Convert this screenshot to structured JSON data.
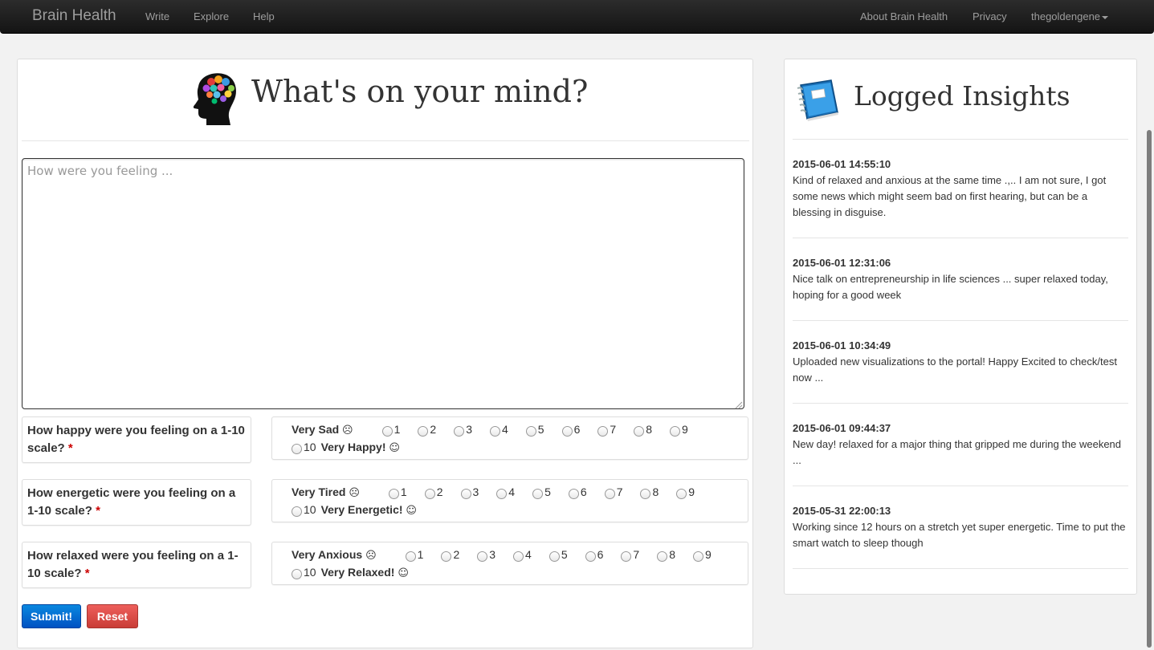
{
  "navbar": {
    "brand": "Brain Health",
    "left_links": [
      "Write",
      "Explore",
      "Help"
    ],
    "right_links": [
      "About Brain Health",
      "Privacy"
    ],
    "user": "thegoldengene"
  },
  "write_panel": {
    "title": "What's on your mind?",
    "icon": "brain-head-icon",
    "textarea_placeholder": "How were you feeling ...",
    "textarea_value": "",
    "questions": [
      {
        "label": "How happy were you feeling on a 1-10 scale?",
        "required_mark": "*",
        "low_label": "Very Sad",
        "low_emoji": "☹",
        "high_label": "Very Happy!",
        "high_emoji": "☺",
        "options": [
          "1",
          "2",
          "3",
          "4",
          "5",
          "6",
          "7",
          "8",
          "9",
          "10"
        ]
      },
      {
        "label": "How energetic were you feeling on a 1-10 scale?",
        "required_mark": "*",
        "low_label": "Very Tired",
        "low_emoji": "☹",
        "high_label": "Very Energetic!",
        "high_emoji": "☺",
        "options": [
          "1",
          "2",
          "3",
          "4",
          "5",
          "6",
          "7",
          "8",
          "9",
          "10"
        ]
      },
      {
        "label": "How relaxed were you feeling on a 1-10 scale?",
        "required_mark": "*",
        "low_label": "Very Anxious",
        "low_emoji": "☹",
        "high_label": "Very Relaxed!",
        "high_emoji": "☺",
        "options": [
          "1",
          "2",
          "3",
          "4",
          "5",
          "6",
          "7",
          "8",
          "9",
          "10"
        ]
      }
    ],
    "submit_label": "Submit!",
    "reset_label": "Reset",
    "colors": {
      "primary": "#0067d6",
      "danger": "#da4f49"
    }
  },
  "insights_panel": {
    "title": "Logged Insights",
    "icon": "notebook-icon",
    "entries": [
      {
        "timestamp": "2015-06-01 14:55:10",
        "text": "Kind of relaxed and anxious at the same time .,.. I am not sure, I got some news which might seem bad on first hearing, but can be a blessing in disguise."
      },
      {
        "timestamp": "2015-06-01 12:31:06",
        "text": "Nice talk on entrepreneurship in life sciences ... super relaxed today, hoping for a good week"
      },
      {
        "timestamp": "2015-06-01 10:34:49",
        "text": "Uploaded new visualizations to the portal! Happy Excited to check/test now ..."
      },
      {
        "timestamp": "2015-06-01 09:44:37",
        "text": "New day! relaxed for a major thing that gripped me during the weekend ..."
      },
      {
        "timestamp": "2015-05-31 22:00:13",
        "text": "Working since 12 hours on a stretch yet super energetic. Time to put the smart watch to sleep though"
      }
    ]
  }
}
